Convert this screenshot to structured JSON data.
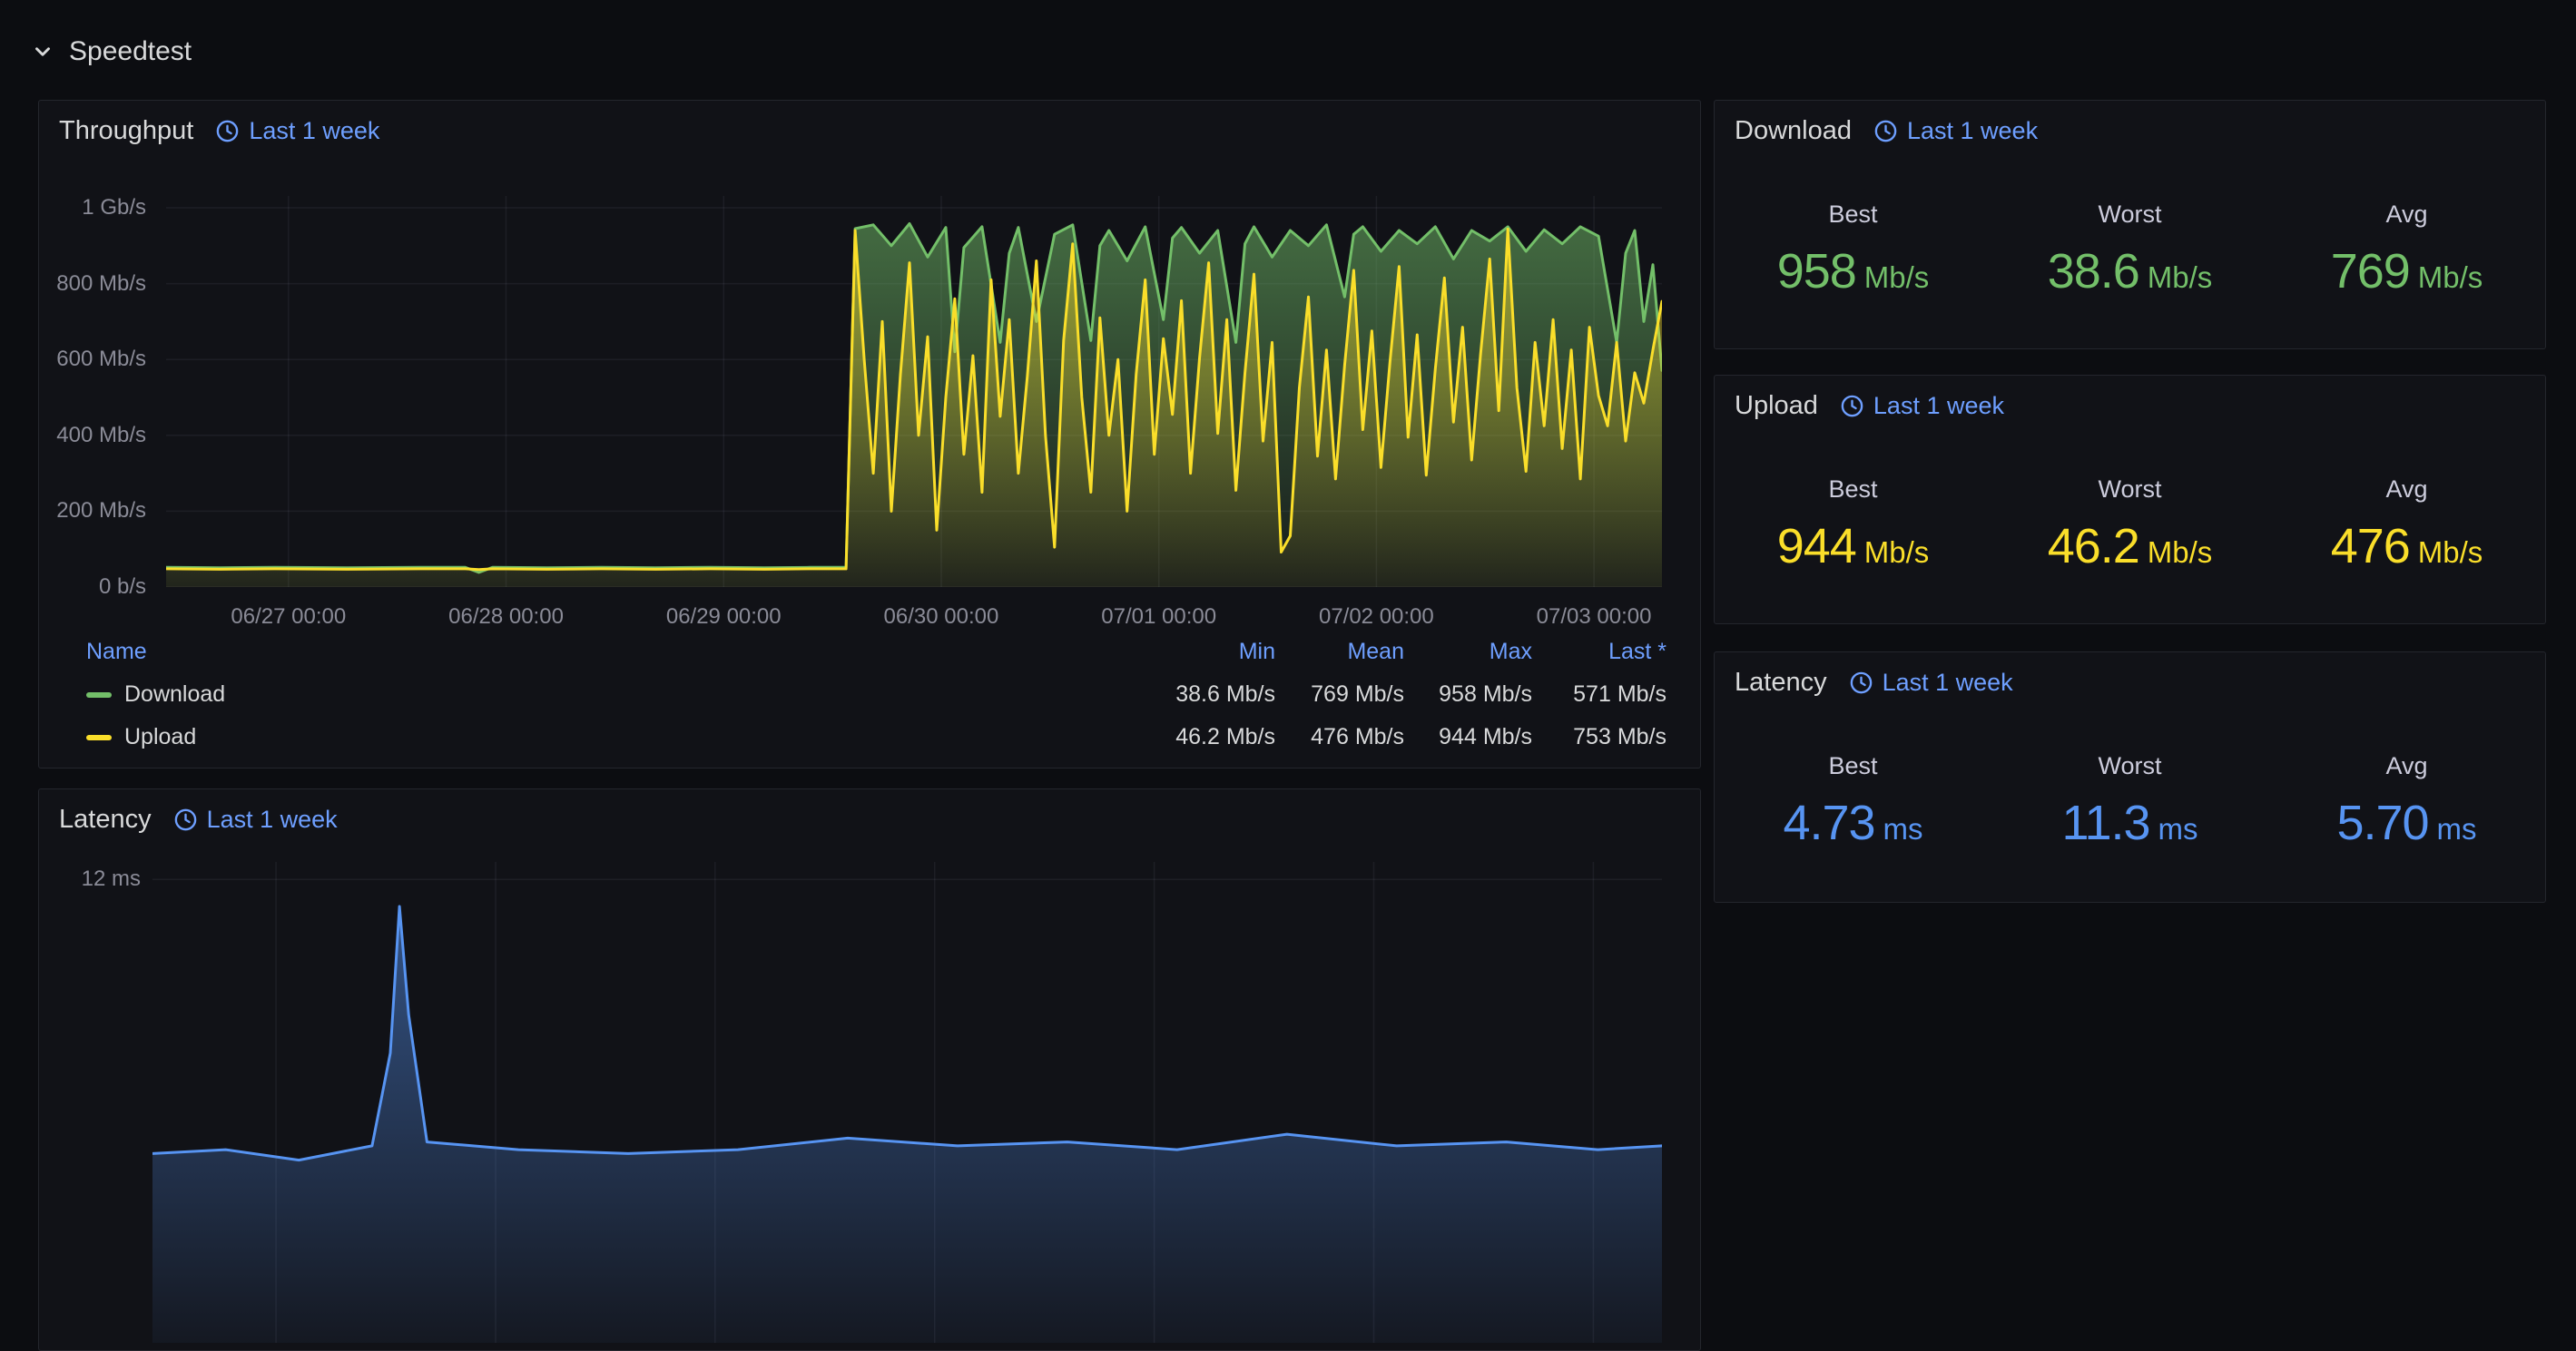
{
  "section": {
    "title": "Speedtest"
  },
  "colors": {
    "link": "#6e9fff",
    "green": "#73bf69",
    "yellow": "#fade2a",
    "blue": "#5794f2"
  },
  "panels": {
    "throughput": {
      "title": "Throughput",
      "time_range": "Last 1 week",
      "legend": {
        "headers": {
          "name": "Name",
          "min": "Min",
          "mean": "Mean",
          "max": "Max",
          "last": "Last *"
        },
        "rows": [
          {
            "name": "Download",
            "color": "#73bf69",
            "min": "38.6 Mb/s",
            "mean": "769 Mb/s",
            "max": "958 Mb/s",
            "last": "571 Mb/s"
          },
          {
            "name": "Upload",
            "color": "#fade2a",
            "min": "46.2 Mb/s",
            "mean": "476 Mb/s",
            "max": "944 Mb/s",
            "last": "753 Mb/s"
          }
        ]
      }
    },
    "download_stat": {
      "title": "Download",
      "time_range": "Last 1 week",
      "color": "#73bf69",
      "stats": [
        {
          "label": "Best",
          "value": "958",
          "unit": "Mb/s"
        },
        {
          "label": "Worst",
          "value": "38.6",
          "unit": "Mb/s"
        },
        {
          "label": "Avg",
          "value": "769",
          "unit": "Mb/s"
        }
      ]
    },
    "upload_stat": {
      "title": "Upload",
      "time_range": "Last 1 week",
      "color": "#fade2a",
      "stats": [
        {
          "label": "Best",
          "value": "944",
          "unit": "Mb/s"
        },
        {
          "label": "Worst",
          "value": "46.2",
          "unit": "Mb/s"
        },
        {
          "label": "Avg",
          "value": "476",
          "unit": "Mb/s"
        }
      ]
    },
    "latency_stat": {
      "title": "Latency",
      "time_range": "Last 1 week",
      "color": "#5794f2",
      "stats": [
        {
          "label": "Best",
          "value": "4.73",
          "unit": "ms"
        },
        {
          "label": "Worst",
          "value": "11.3",
          "unit": "ms"
        },
        {
          "label": "Avg",
          "value": "5.70",
          "unit": "ms"
        }
      ]
    },
    "latency_chart": {
      "title": "Latency",
      "time_range": "Last 1 week"
    }
  },
  "chart_data": [
    {
      "type": "area",
      "title": "Throughput",
      "grid": true,
      "legend_position": "bottom-table",
      "x_axis": {
        "domain_hours": [
          0,
          165
        ],
        "tick_hours": [
          13.5,
          37.5,
          61.5,
          85.5,
          109.5,
          133.5,
          157.5
        ],
        "tick_labels": [
          "06/27 00:00",
          "06/28 00:00",
          "06/29 00:00",
          "06/30 00:00",
          "07/01 00:00",
          "07/02 00:00",
          "07/03 00:00"
        ]
      },
      "y_axis": {
        "unit": "Mb/s",
        "ylim": [
          0,
          1031
        ],
        "tick_values": [
          0,
          200,
          400,
          600,
          800,
          1000
        ],
        "tick_labels": [
          "0 b/s",
          "200 Mb/s",
          "400 Mb/s",
          "600 Mb/s",
          "800 Mb/s",
          "1 Gb/s"
        ]
      },
      "series": [
        {
          "name": "Download",
          "color": "#73bf69",
          "points": [
            [
              0,
              52
            ],
            [
              6,
              51
            ],
            [
              12,
              52
            ],
            [
              20,
              51
            ],
            [
              28,
              52
            ],
            [
              33,
              52
            ],
            [
              34.5,
              38.6
            ],
            [
              36,
              52
            ],
            [
              42,
              51
            ],
            [
              48,
              52
            ],
            [
              54,
              51
            ],
            [
              60,
              52
            ],
            [
              66,
              51
            ],
            [
              71,
              52
            ],
            [
              75,
              52
            ],
            [
              76,
              945
            ],
            [
              78,
              955
            ],
            [
              80,
              900
            ],
            [
              82,
              958
            ],
            [
              84,
              870
            ],
            [
              86,
              948
            ],
            [
              87,
              620
            ],
            [
              88,
              895
            ],
            [
              90,
              950
            ],
            [
              92,
              645
            ],
            [
              93,
              880
            ],
            [
              94,
              948
            ],
            [
              96,
              700
            ],
            [
              98,
              930
            ],
            [
              100,
              955
            ],
            [
              102,
              650
            ],
            [
              103,
              900
            ],
            [
              104,
              940
            ],
            [
              106,
              860
            ],
            [
              108,
              950
            ],
            [
              110,
              705
            ],
            [
              111,
              920
            ],
            [
              112,
              948
            ],
            [
              114,
              880
            ],
            [
              116,
              940
            ],
            [
              118,
              645
            ],
            [
              119,
              905
            ],
            [
              120,
              950
            ],
            [
              122,
              870
            ],
            [
              124,
              940
            ],
            [
              126,
              900
            ],
            [
              128,
              955
            ],
            [
              130,
              765
            ],
            [
              131,
              930
            ],
            [
              132,
              950
            ],
            [
              134,
              885
            ],
            [
              136,
              940
            ],
            [
              138,
              905
            ],
            [
              140,
              950
            ],
            [
              142,
              865
            ],
            [
              144,
              940
            ],
            [
              146,
              912
            ],
            [
              148,
              950
            ],
            [
              150,
              885
            ],
            [
              152,
              942
            ],
            [
              154,
              905
            ],
            [
              156,
              950
            ],
            [
              158,
              925
            ],
            [
              160,
              645
            ],
            [
              161,
              880
            ],
            [
              162,
              940
            ],
            [
              163,
              700
            ],
            [
              164,
              850
            ],
            [
              165,
              571
            ]
          ]
        },
        {
          "name": "Upload",
          "color": "#fade2a",
          "points": [
            [
              0,
              48
            ],
            [
              6,
              47
            ],
            [
              12,
              48
            ],
            [
              20,
              47
            ],
            [
              28,
              48
            ],
            [
              33,
              48
            ],
            [
              34.5,
              46.2
            ],
            [
              36,
              48
            ],
            [
              42,
              47
            ],
            [
              48,
              48
            ],
            [
              54,
              47
            ],
            [
              60,
              48
            ],
            [
              66,
              47
            ],
            [
              71,
              48
            ],
            [
              75,
              48
            ],
            [
              76,
              940
            ],
            [
              77,
              600
            ],
            [
              78,
              300
            ],
            [
              79,
              700
            ],
            [
              80,
              200
            ],
            [
              81,
              560
            ],
            [
              82,
              855
            ],
            [
              83,
              400
            ],
            [
              84,
              660
            ],
            [
              85,
              150
            ],
            [
              86,
              500
            ],
            [
              87,
              760
            ],
            [
              88,
              350
            ],
            [
              89,
              610
            ],
            [
              90,
              250
            ],
            [
              91,
              810
            ],
            [
              92,
              450
            ],
            [
              93,
              705
            ],
            [
              94,
              300
            ],
            [
              95,
              555
            ],
            [
              96,
              860
            ],
            [
              97,
              400
            ],
            [
              98,
              105
            ],
            [
              99,
              650
            ],
            [
              100,
              905
            ],
            [
              101,
              500
            ],
            [
              102,
              250
            ],
            [
              103,
              710
            ],
            [
              104,
              400
            ],
            [
              105,
              600
            ],
            [
              106,
              200
            ],
            [
              107,
              560
            ],
            [
              108,
              810
            ],
            [
              109,
              350
            ],
            [
              110,
              655
            ],
            [
              111,
              455
            ],
            [
              112,
              755
            ],
            [
              113,
              300
            ],
            [
              114,
              605
            ],
            [
              115,
              855
            ],
            [
              116,
              405
            ],
            [
              117,
              705
            ],
            [
              118,
              255
            ],
            [
              119,
              565
            ],
            [
              120,
              825
            ],
            [
              121,
              385
            ],
            [
              122,
              645
            ],
            [
              123,
              92
            ],
            [
              124,
              135
            ],
            [
              125,
              525
            ],
            [
              126,
              765
            ],
            [
              127,
              345
            ],
            [
              128,
              625
            ],
            [
              129,
              285
            ],
            [
              130,
              585
            ],
            [
              131,
              835
            ],
            [
              132,
              415
            ],
            [
              133,
              675
            ],
            [
              134,
              315
            ],
            [
              135,
              595
            ],
            [
              136,
              845
            ],
            [
              137,
              395
            ],
            [
              138,
              665
            ],
            [
              139,
              295
            ],
            [
              140,
              575
            ],
            [
              141,
              815
            ],
            [
              142,
              435
            ],
            [
              143,
              685
            ],
            [
              144,
              335
            ],
            [
              145,
              615
            ],
            [
              146,
              865
            ],
            [
              147,
              465
            ],
            [
              148,
              944
            ],
            [
              149,
              525
            ],
            [
              150,
              305
            ],
            [
              151,
              645
            ],
            [
              152,
              425
            ],
            [
              153,
              705
            ],
            [
              154,
              365
            ],
            [
              155,
              625
            ],
            [
              156,
              285
            ],
            [
              157,
              685
            ],
            [
              158,
              505
            ],
            [
              159,
              425
            ],
            [
              160,
              645
            ],
            [
              161,
              385
            ],
            [
              162,
              565
            ],
            [
              163,
              485
            ],
            [
              164,
              625
            ],
            [
              165,
              753
            ]
          ]
        }
      ]
    },
    {
      "type": "area",
      "title": "Latency",
      "grid": true,
      "partially_visible": true,
      "x_axis": {
        "domain_hours": [
          0,
          165
        ],
        "tick_hours": [
          13.5,
          37.5,
          61.5,
          85.5,
          109.5,
          133.5,
          157.5
        ]
      },
      "y_axis": {
        "unit": "ms",
        "ylim": [
          0,
          12.45
        ],
        "tick_values": [
          12
        ],
        "tick_labels": [
          "12 ms"
        ]
      },
      "series": [
        {
          "name": "Latency",
          "color": "#5794f2",
          "points": [
            [
              0,
              4.9
            ],
            [
              8,
              5.0
            ],
            [
              16,
              4.73
            ],
            [
              24,
              5.1
            ],
            [
              26,
              7.5
            ],
            [
              27,
              11.3
            ],
            [
              28,
              8.5
            ],
            [
              30,
              5.2
            ],
            [
              40,
              5.0
            ],
            [
              52,
              4.9
            ],
            [
              64,
              5.0
            ],
            [
              76,
              5.3
            ],
            [
              88,
              5.1
            ],
            [
              100,
              5.2
            ],
            [
              112,
              5.0
            ],
            [
              124,
              5.4
            ],
            [
              136,
              5.1
            ],
            [
              148,
              5.2
            ],
            [
              158,
              5.0
            ],
            [
              165,
              5.1
            ]
          ]
        }
      ]
    }
  ]
}
